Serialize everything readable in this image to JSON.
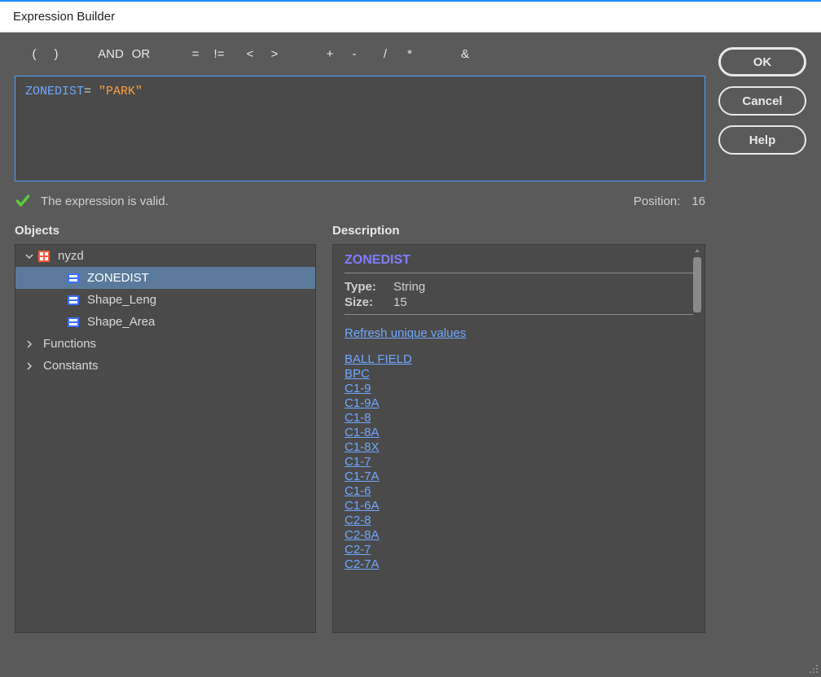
{
  "window": {
    "title": "Expression Builder"
  },
  "operators": {
    "lparen": "(",
    "rparen": ")",
    "and": "AND",
    "or": "OR",
    "eq": "=",
    "neq": "!=",
    "lt": "<",
    "gt": ">",
    "plus": "+",
    "minus": "-",
    "div": "/",
    "mul": "*",
    "amp": "&"
  },
  "expression": {
    "field": "ZONEDIST",
    "operator": "=",
    "value": "\"PARK\""
  },
  "validation": {
    "message": "The expression is valid.",
    "position_label": "Position:",
    "position_value": "16"
  },
  "buttons": {
    "ok": "OK",
    "cancel": "Cancel",
    "help": "Help"
  },
  "panels": {
    "objects_label": "Objects",
    "description_label": "Description"
  },
  "tree": {
    "root": "nyzd",
    "fields": [
      "ZONEDIST",
      "Shape_Leng",
      "Shape_Area"
    ],
    "functions": "Functions",
    "constants": "Constants"
  },
  "description": {
    "title": "ZONEDIST",
    "type_label": "Type:",
    "type_value": "String",
    "size_label": "Size:",
    "size_value": "15",
    "refresh_link": "Refresh unique values",
    "values": [
      "BALL FIELD",
      "BPC",
      "C1-9",
      "C1-9A",
      "C1-8",
      "C1-8A",
      "C1-8X",
      "C1-7",
      "C1-7A",
      "C1-6",
      "C1-6A",
      "C2-8",
      "C2-8A",
      "C2-7",
      "C2-7A"
    ]
  }
}
